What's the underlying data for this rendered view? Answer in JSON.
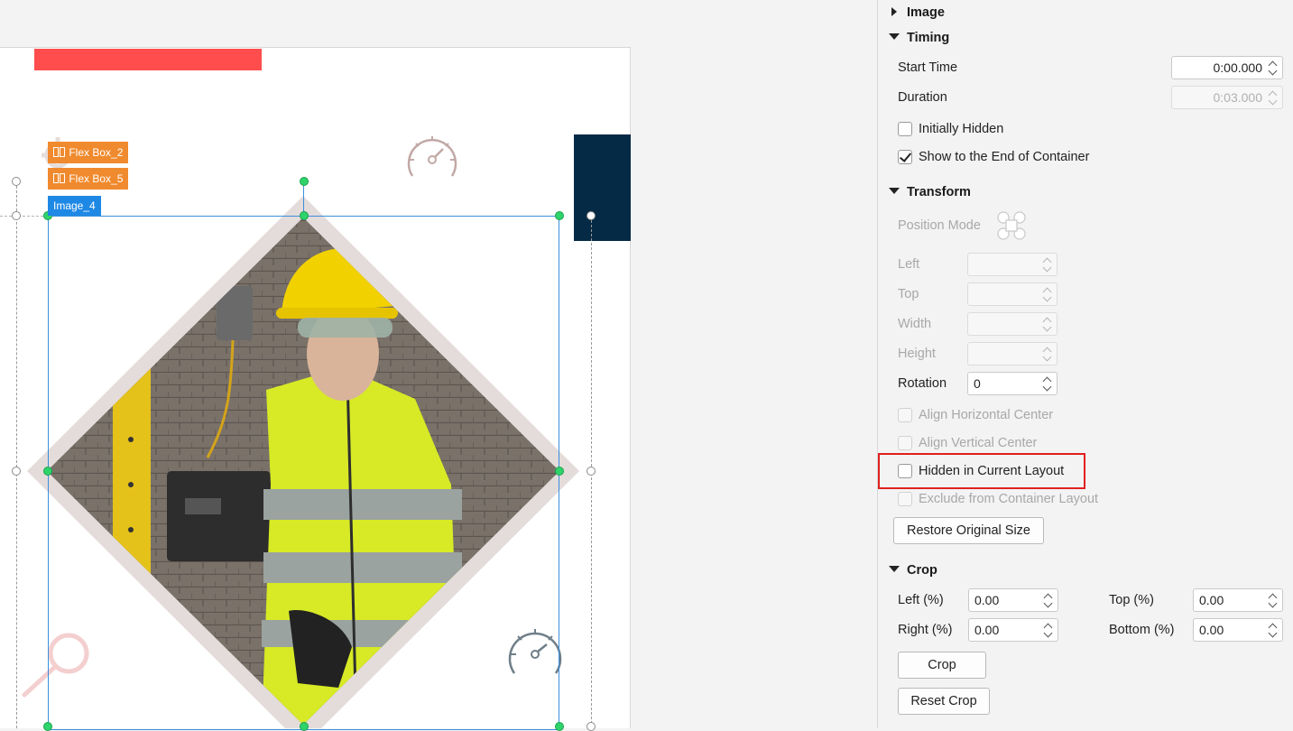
{
  "canvas": {
    "tags": {
      "flex_box_2": "Flex Box_2",
      "flex_box_5": "Flex Box_5",
      "image_4": "Image_4"
    },
    "colors": {
      "red_bar": "#ff4d4d",
      "navy_block": "#052a45",
      "selection": "#1e88e5",
      "diamond_frame": "#e4dcda"
    },
    "icons": [
      "gear-icon",
      "gauge-icon",
      "magnifier-icon"
    ]
  },
  "panel": {
    "image_section": "Image",
    "timing": {
      "title": "Timing",
      "start_time_label": "Start Time",
      "start_time_value": "0:00.000",
      "duration_label": "Duration",
      "duration_value": "0:03.000",
      "initially_hidden": "Initially Hidden",
      "show_to_end": "Show to the End of Container"
    },
    "transform": {
      "title": "Transform",
      "position_mode": "Position Mode",
      "left": "Left",
      "top": "Top",
      "width": "Width",
      "height": "Height",
      "rotation": "Rotation",
      "rotation_value": "0",
      "align_h": "Align Horizontal Center",
      "align_v": "Align Vertical Center",
      "hidden_in_layout": "Hidden in Current Layout",
      "exclude_layout": "Exclude from Container Layout",
      "restore_size": "Restore Original Size"
    },
    "crop": {
      "title": "Crop",
      "left_label": "Left (%)",
      "left_value": "0.00",
      "top_label": "Top (%)",
      "top_value": "0.00",
      "right_label": "Right (%)",
      "right_value": "0.00",
      "bottom_label": "Bottom (%)",
      "bottom_value": "0.00",
      "crop_button": "Crop",
      "reset_button": "Reset Crop"
    }
  }
}
